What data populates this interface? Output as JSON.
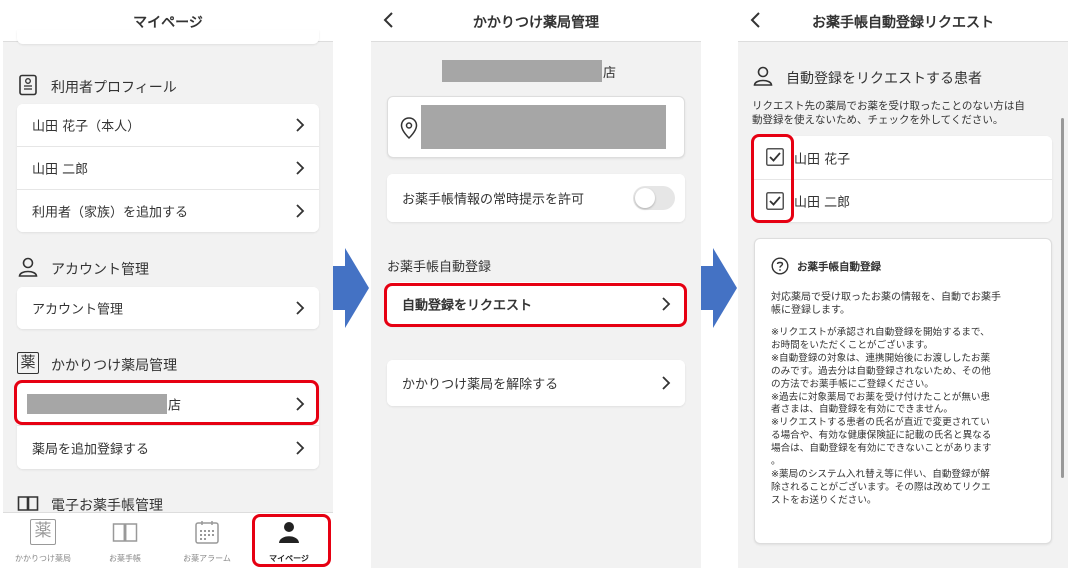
{
  "screen1": {
    "title": "マイページ",
    "profile_section": "利用者プロフィール",
    "users": [
      "山田 花子（本人）",
      "山田 二郎"
    ],
    "add_user": "利用者（家族）を追加する",
    "account_section": "アカウント管理",
    "account_item": "アカウント管理",
    "pharmacy_section": "かかりつけ薬局管理",
    "pharmacy_suffix": "店",
    "add_pharmacy": "薬局を追加登録する",
    "ebook_section": "電子お薬手帳管理",
    "tabs": [
      "かかりつけ薬局",
      "お薬手帳",
      "お薬アラーム",
      "マイページ"
    ],
    "pharmacy_icon_char": "薬",
    "active_tab": "マイページ"
  },
  "screen2": {
    "title": "かかりつけ薬局管理",
    "store_suffix": "店",
    "allow_label": "お薬手帳情報の常時提示を許可",
    "auto_section": "お薬手帳自動登録",
    "request_label": "自動登録をリクエスト",
    "release_label": "かかりつけ薬局を解除する"
  },
  "screen3": {
    "title": "お薬手帳自動登録リクエスト",
    "patients_heading": "自動登録をリクエストする患者",
    "note_lines": [
      "リクエスト先の薬局でお薬を受け取ったことのない方は自",
      "動登録を使えないため、チェックを外してください。"
    ],
    "patients": [
      "山田 花子",
      "山田 二郎"
    ],
    "info_title": "お薬手帳自動登録",
    "info_intro": [
      "対応薬局で受け取ったお薬の情報を、自動でお薬手",
      "帳に登録します。"
    ],
    "info_notes": [
      "※リクエストが承認され自動登録を開始するまで、",
      "お時間をいただくことがございます。",
      "※自動登録の対象は、連携開始後にお渡ししたお薬",
      "のみです。過去分は自動登録されないため、その他",
      "の方法でお薬手帳にご登録ください。",
      "※過去に対象薬局でお薬を受け付けたことが無い患",
      "者さまは、自動登録を有効にできません。",
      "※リクエストする患者の氏名が直近で変更されてい",
      "る場合や、有効な健康保険証に記載の氏名と異なる",
      "場合は、自動登録を有効にできないことがあります",
      "。",
      "※薬局のシステム入れ替え等に伴い、自動登録が解",
      "除されることがございます。その際は改めてリクエ",
      "ストをお送りください。"
    ]
  },
  "colors": {
    "highlight": "#e60012",
    "arrow": "#4472c4",
    "redaction": "#a6a6a6"
  }
}
